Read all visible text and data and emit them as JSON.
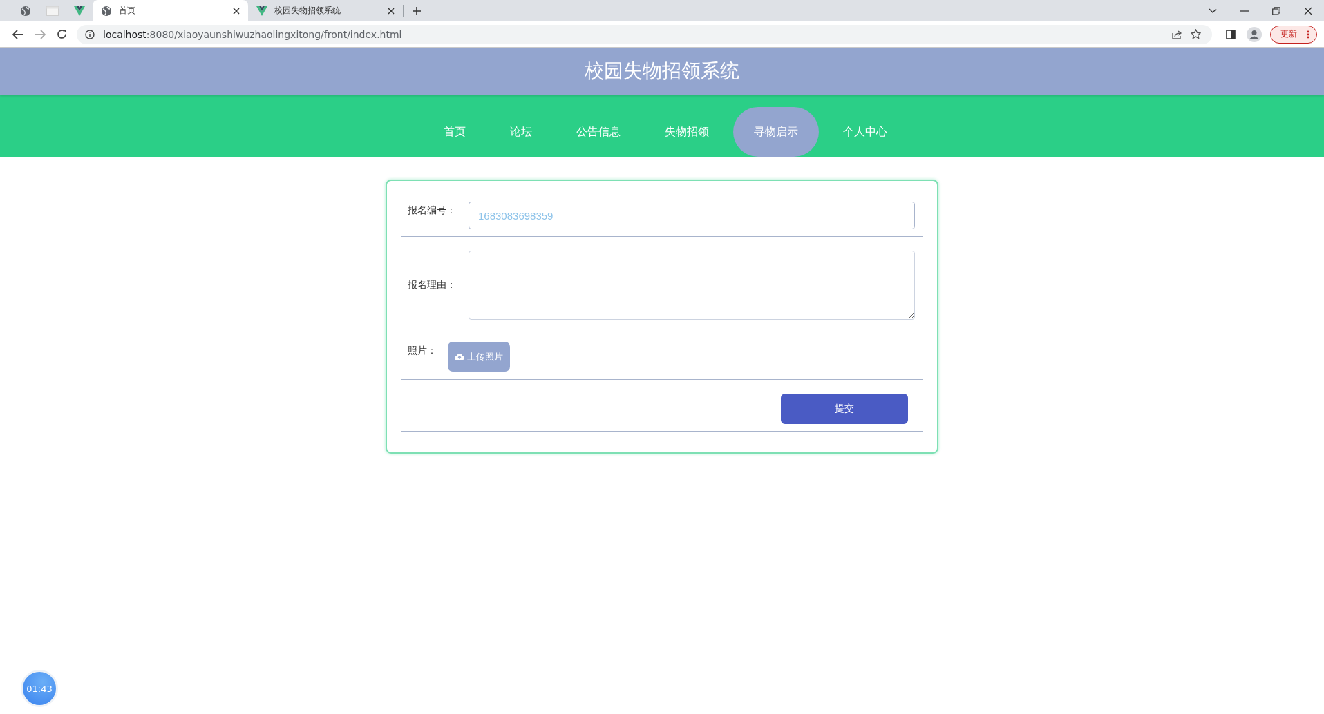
{
  "browser": {
    "tabs": [
      {
        "title": "首页",
        "selected": true
      },
      {
        "title": "校园失物招领系统",
        "selected": false
      }
    ],
    "url_host": "localhost",
    "url_rest": ":8080/xiaoyaunshiwuzhaolingxitong/front/index.html",
    "update_button": "更新"
  },
  "header": {
    "title": "校园失物招领系统"
  },
  "nav": [
    {
      "label": "首页",
      "selected": false
    },
    {
      "label": "论坛",
      "selected": false
    },
    {
      "label": "公告信息",
      "selected": false
    },
    {
      "label": "失物招领",
      "selected": false
    },
    {
      "label": "寻物启示",
      "selected": true
    },
    {
      "label": "个人中心",
      "selected": false
    }
  ],
  "form": {
    "fields": [
      {
        "kind": "input",
        "label": "报名编号：",
        "value": "1683083698359"
      },
      {
        "kind": "textarea",
        "label": "报名理由："
      },
      {
        "kind": "upload",
        "label": "照片：",
        "button": "上传照片"
      }
    ],
    "submit": "提交"
  },
  "timer": "01:43"
}
